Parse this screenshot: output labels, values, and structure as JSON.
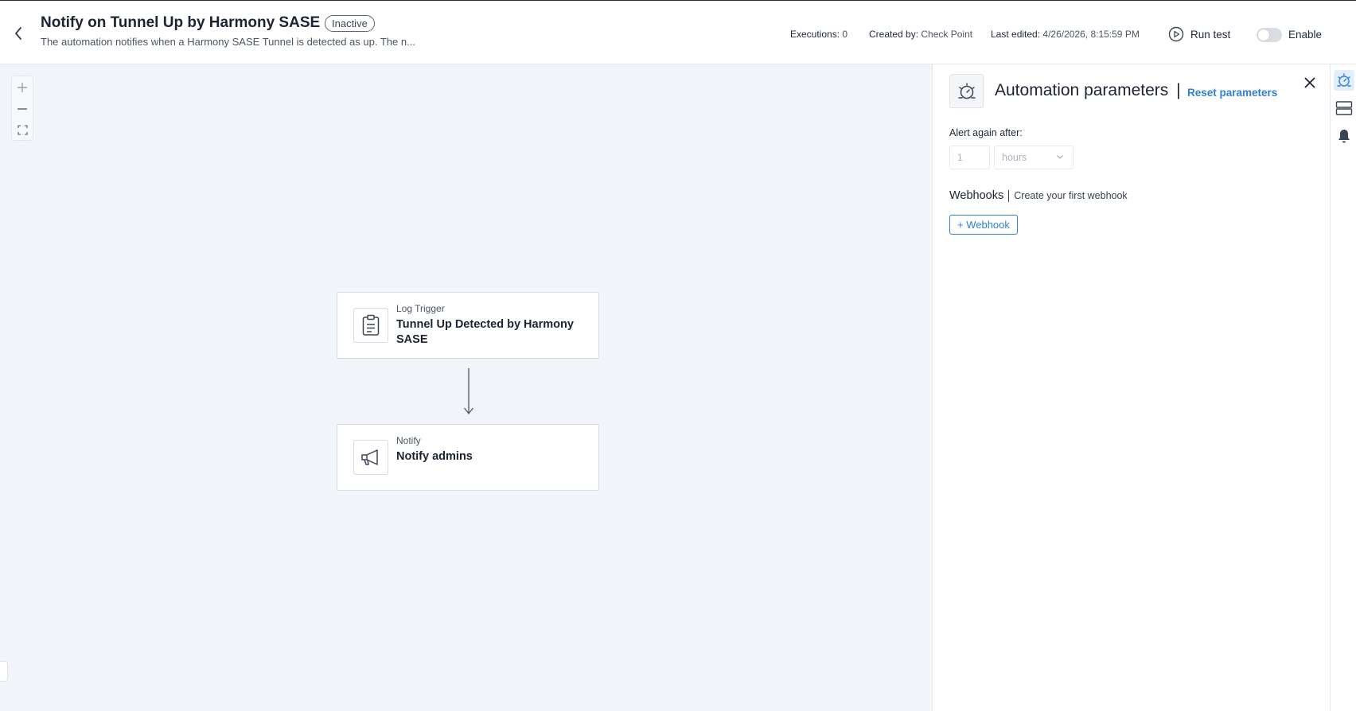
{
  "header": {
    "title": "Notify on Tunnel Up by Harmony SASE",
    "status": "Inactive",
    "description": "The automation notifies when a Harmony SASE Tunnel is detected as up. The n...",
    "executions_label": "Executions:",
    "executions_value": "0",
    "created_by_label": "Created by:",
    "created_by_value": "Check Point",
    "last_edited_label": "Last edited:",
    "last_edited_value": "4/26/2026, 8:15:59 PM",
    "run_test_label": "Run test",
    "enable_label": "Enable",
    "enabled": false
  },
  "canvas": {
    "zoom_controls": [
      "zoom-in-icon",
      "zoom-out-icon",
      "fit-view-icon"
    ],
    "nodes": [
      {
        "type": "Log Trigger",
        "title": "Tunnel Up Detected by Harmony SASE",
        "icon": "clipboard-icon"
      },
      {
        "type": "Notify",
        "title": "Notify admins",
        "icon": "megaphone-icon"
      }
    ]
  },
  "panel": {
    "title": "Automation parameters",
    "reset_label": "Reset parameters",
    "alert_again_label": "Alert again after:",
    "alert_again_value": "1",
    "alert_again_unit": "hours",
    "webhooks_label": "Webhooks",
    "webhooks_hint": "Create your first webhook",
    "add_webhook_label": "+ Webhook"
  },
  "rail": {
    "items": [
      "automation-parameters-icon",
      "layers-icon",
      "bell-icon"
    ]
  },
  "colors": {
    "accent": "#2f7fd8",
    "canvas_bg": "#f1f4f8"
  }
}
